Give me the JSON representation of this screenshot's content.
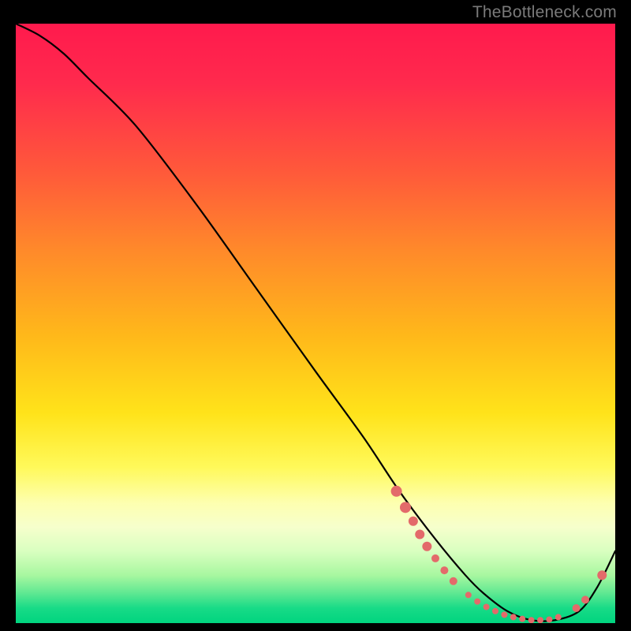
{
  "watermark": "TheBottleneck.com",
  "chart_data": {
    "type": "line",
    "title": "",
    "xlabel": "",
    "ylabel": "",
    "xlim": [
      0,
      100
    ],
    "ylim": [
      0,
      100
    ],
    "grid": false,
    "legend": false,
    "background": "gradient-red-yellow-green",
    "series": [
      {
        "name": "bottleneck-curve",
        "color": "#000000",
        "x": [
          0,
          4,
          8,
          12,
          20,
          30,
          40,
          50,
          58,
          64,
          70,
          75,
          78,
          82,
          86,
          90,
          94,
          97,
          100
        ],
        "y": [
          100,
          98,
          95,
          91,
          83,
          70,
          56,
          42,
          31,
          22,
          14,
          8,
          5,
          2,
          0.5,
          0.5,
          2,
          6,
          12
        ]
      }
    ],
    "points": {
      "name": "highlight-dots",
      "color": "#e36a6a",
      "radius_large": 6,
      "radius_small": 5,
      "data": [
        {
          "x": 63.5,
          "y": 22.0,
          "r": 7
        },
        {
          "x": 65.0,
          "y": 19.3,
          "r": 7
        },
        {
          "x": 66.3,
          "y": 17.0,
          "r": 6
        },
        {
          "x": 67.4,
          "y": 14.8,
          "r": 6
        },
        {
          "x": 68.6,
          "y": 12.8,
          "r": 6
        },
        {
          "x": 70.0,
          "y": 10.8,
          "r": 5
        },
        {
          "x": 71.5,
          "y": 8.8,
          "r": 5
        },
        {
          "x": 73.0,
          "y": 7.0,
          "r": 5
        },
        {
          "x": 75.5,
          "y": 4.7,
          "r": 4
        },
        {
          "x": 77.0,
          "y": 3.6,
          "r": 4
        },
        {
          "x": 78.5,
          "y": 2.7,
          "r": 4
        },
        {
          "x": 80.0,
          "y": 2.0,
          "r": 4
        },
        {
          "x": 81.5,
          "y": 1.4,
          "r": 4
        },
        {
          "x": 83.0,
          "y": 1.0,
          "r": 4
        },
        {
          "x": 84.5,
          "y": 0.7,
          "r": 4
        },
        {
          "x": 86.0,
          "y": 0.5,
          "r": 4
        },
        {
          "x": 87.5,
          "y": 0.5,
          "r": 4
        },
        {
          "x": 89.0,
          "y": 0.6,
          "r": 4
        },
        {
          "x": 90.5,
          "y": 1.0,
          "r": 4
        },
        {
          "x": 93.5,
          "y": 2.5,
          "r": 5
        },
        {
          "x": 95.0,
          "y": 3.9,
          "r": 5
        },
        {
          "x": 97.8,
          "y": 8.0,
          "r": 6
        }
      ]
    }
  }
}
